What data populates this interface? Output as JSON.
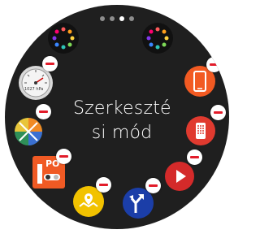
{
  "page_indicator": {
    "count": 4,
    "active": 2
  },
  "edit_mode_title": [
    "Szerkeszté",
    "si mód"
  ],
  "widgets": {
    "weather": {
      "name": "weather-widget",
      "value": "1027 hPa"
    },
    "bitmoji": {
      "name": "bitmoji-widget"
    },
    "pokemon": {
      "name": "pokemon-widget",
      "label": "PO"
    },
    "maps": {
      "name": "maps-widget"
    },
    "navigation": {
      "name": "navigation-widget"
    },
    "play": {
      "name": "play-widget"
    },
    "speaker": {
      "name": "speaker-widget"
    },
    "phone": {
      "name": "phone-widget"
    },
    "empty_slots": [
      "apps-slot-left",
      "apps-slot-right"
    ]
  },
  "colors": {
    "background": "#1f1f1f",
    "remove_badge": "#e21c2a",
    "orange": "#f05a24",
    "red": "#d32f2f",
    "blue": "#1b3ea8",
    "yellow": "#f2c200"
  }
}
